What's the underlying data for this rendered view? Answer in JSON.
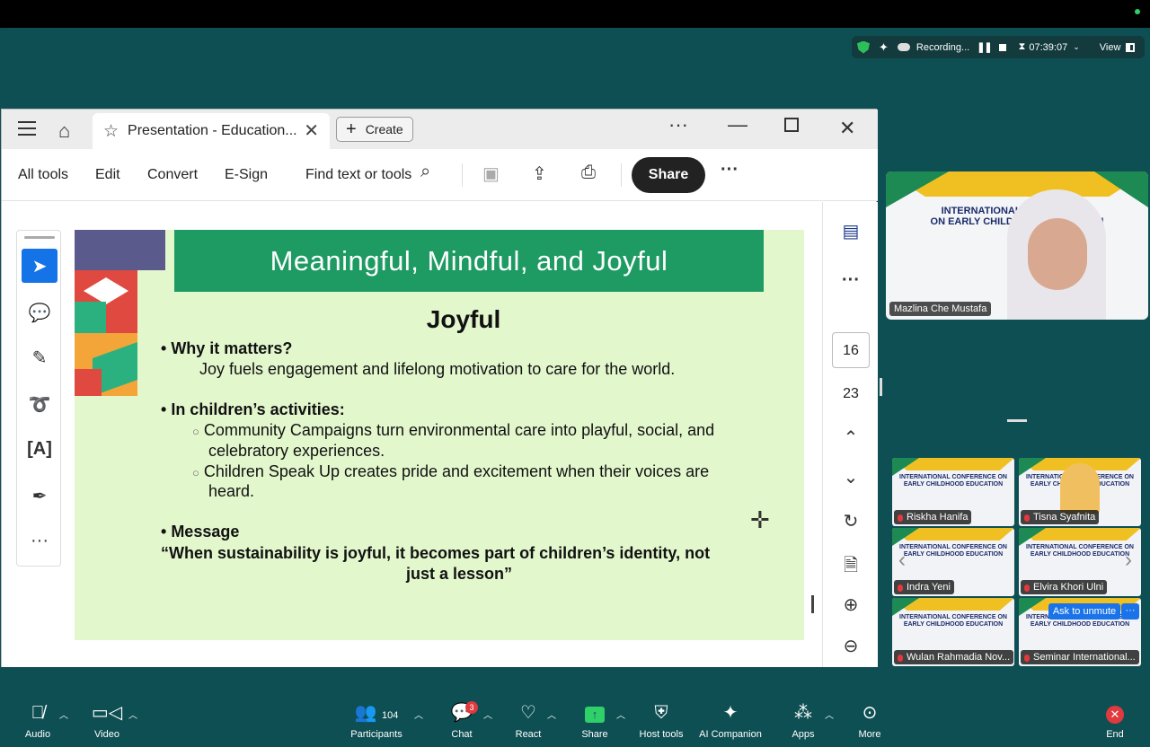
{
  "zoom_status": {
    "recording": "Recording...",
    "timer": "07:39:07",
    "view": "View"
  },
  "acrobat": {
    "tab_title": "Presentation - Education...",
    "create_label": "Create",
    "toolbar": {
      "all_tools": "All tools",
      "edit": "Edit",
      "convert": "Convert",
      "esign": "E-Sign",
      "find": "Find text or tools",
      "share": "Share"
    },
    "page_current": "16",
    "page_total": "23"
  },
  "slide": {
    "banner": "Meaningful, Mindful, and Joyful",
    "heading": "Joyful",
    "why_label": "Why it matters?",
    "why_text": "Joy fuels engagement and lifelong motivation to care for the world.",
    "activities_label": "In children’s activities:",
    "act1_line1": "Community Campaigns turn environmental care into playful, social, and",
    "act1_line2": "celebratory experiences.",
    "act2_line1": "Children Speak Up creates pride and excitement when their voices are",
    "act2_line2": "heard.",
    "message_label": "Message",
    "quote_line1": "“When sustainability is joyful, it becomes part of children’s identity, not",
    "quote_line2": "just a lesson”"
  },
  "speaker": {
    "name": "Mazlina Che Mustafa",
    "conf_line1": "INTERNATIONAL CONFERENCE",
    "conf_line2": "ON EARLY CHILDHOOD EDUCATION"
  },
  "gallery": [
    {
      "name": "Riskha Hanifa"
    },
    {
      "name": "Tisna Syafnita"
    },
    {
      "name": "Indra Yeni"
    },
    {
      "name": "Elvira Khori Ulni"
    },
    {
      "name": "Wulan Rahmadia Nov..."
    },
    {
      "name": "Seminar International..."
    }
  ],
  "gallery_header": "INTERNATIONAL CONFERENCE ON EARLY CHILDHOOD EDUCATION",
  "ask_to_unmute": "Ask to unmute",
  "bottombar": {
    "audio": "Audio",
    "video": "Video",
    "participants": "Participants",
    "participants_count": "104",
    "chat": "Chat",
    "chat_badge": "3",
    "react": "React",
    "share": "Share",
    "host_tools": "Host tools",
    "ai_companion": "AI Companion",
    "apps": "Apps",
    "more": "More",
    "end": "End"
  },
  "colors": {
    "zoom_bg": "#0e4f53",
    "slide_bg": "#e3f7cd",
    "banner": "#1e9a63",
    "accent_blue": "#1473e6",
    "end_red": "#e0393e"
  }
}
